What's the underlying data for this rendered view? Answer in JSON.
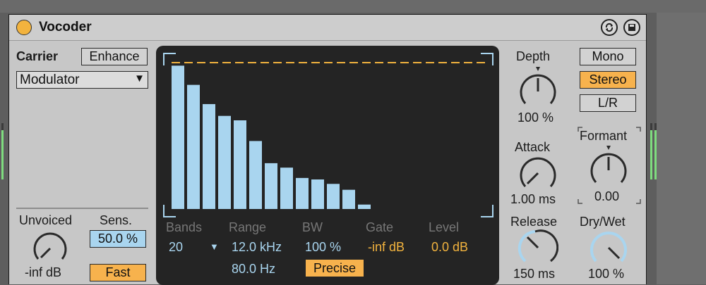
{
  "device": {
    "title": "Vocoder",
    "carrier_label": "Carrier",
    "enhance_label": "Enhance",
    "carrier_source": "Modulator",
    "unvoiced_label": "Unvoiced",
    "unvoiced_value": "-inf dB",
    "sens_label": "Sens.",
    "sens_value": "50.0 %",
    "fast_label": "Fast"
  },
  "display": {
    "bands_label": "Bands",
    "bands_value": "20",
    "range_label": "Range",
    "range_high": "12.0 kHz",
    "range_low": "80.0 Hz",
    "bw_label": "BW",
    "bw_value": "100 %",
    "precise_label": "Precise",
    "gate_label": "Gate",
    "gate_value": "-inf dB",
    "level_label": "Level",
    "level_value": "0.0 dB",
    "band_levels": [
      0.97,
      0.84,
      0.71,
      0.63,
      0.6,
      0.46,
      0.31,
      0.28,
      0.21,
      0.2,
      0.17,
      0.13,
      0.03
    ]
  },
  "controls": {
    "depth_label": "Depth",
    "depth_value": "100 %",
    "attack_label": "Attack",
    "attack_value": "1.00 ms",
    "release_label": "Release",
    "release_value": "150 ms",
    "formant_label": "Formant",
    "formant_value": "0.00",
    "drywet_label": "Dry/Wet",
    "drywet_value": "100 %",
    "mono_label": "Mono",
    "stereo_label": "Stereo",
    "lr_label": "L/R"
  },
  "colors": {
    "accent": "#f7b24d",
    "blue": "#a9d5ef",
    "display_bg": "#242424"
  }
}
